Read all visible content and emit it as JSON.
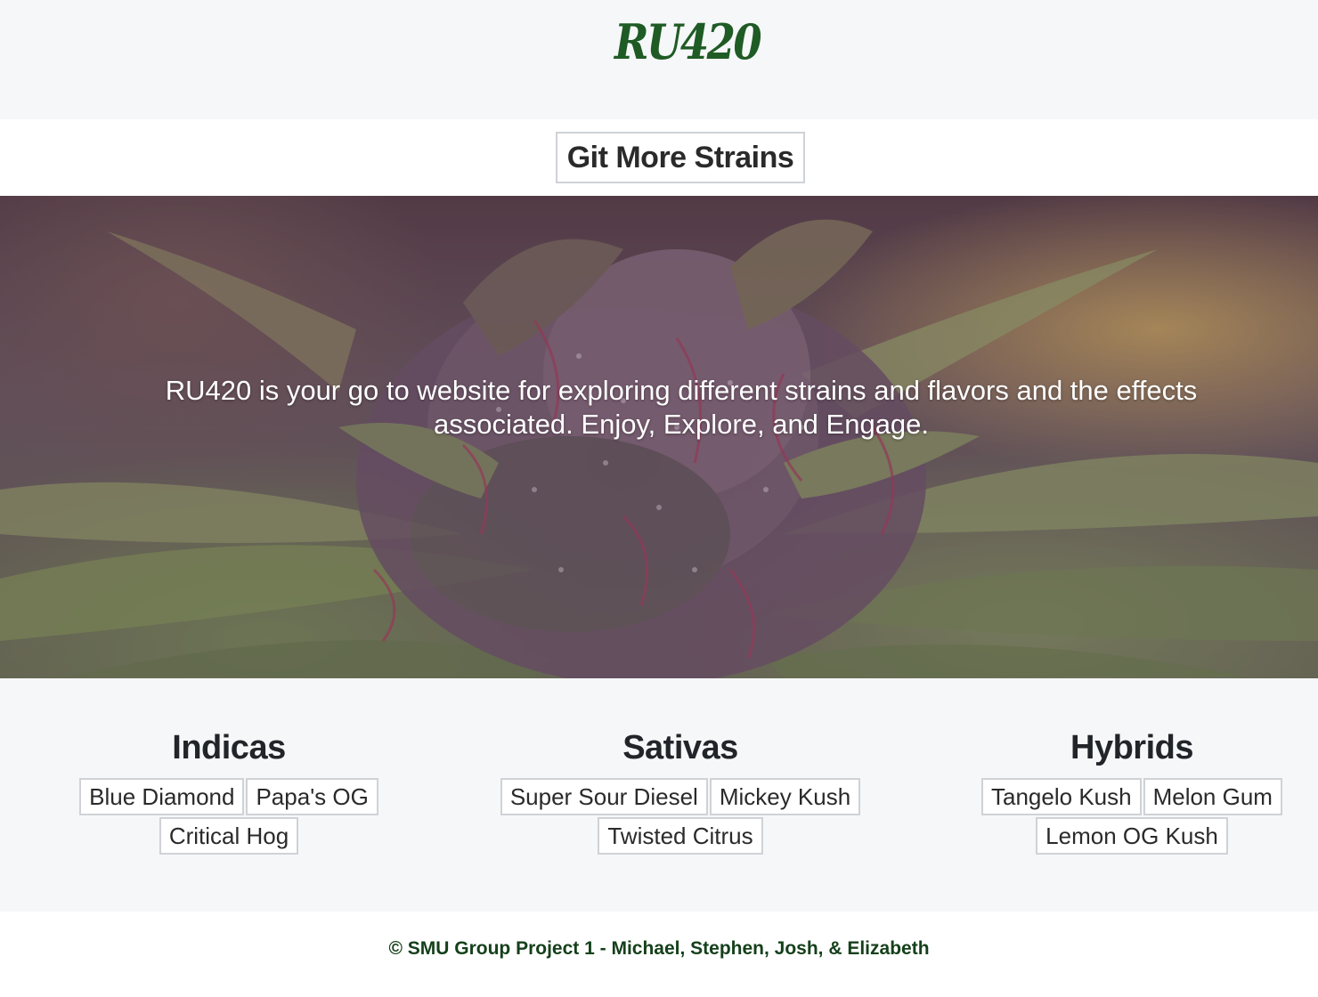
{
  "header": {
    "logo_text": "RU420",
    "logo_color": "#1f5b25"
  },
  "actions": {
    "more_strains_label": "Git More Strains"
  },
  "hero": {
    "tagline": "RU420 is your go to website for exploring different strains and flavors and the effects associated. Enjoy, Explore, and Engage."
  },
  "strains": {
    "indicas": {
      "title": "Indicas",
      "items": [
        "Blue Diamond",
        "Papa's OG",
        "Critical Hog"
      ]
    },
    "sativas": {
      "title": "Sativas",
      "items": [
        "Super Sour Diesel",
        "Mickey Kush",
        "Twisted Citrus"
      ]
    },
    "hybrids": {
      "title": "Hybrids",
      "items": [
        "Tangelo Kush",
        "Melon Gum",
        "Lemon OG Kush"
      ]
    }
  },
  "footer": {
    "text": "© SMU Group Project 1 - Michael, Stephen, Josh, & Elizabeth",
    "text_color": "#15401b"
  }
}
